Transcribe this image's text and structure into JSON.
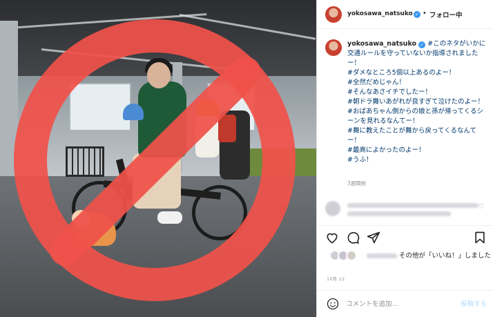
{
  "header": {
    "username": "yokosawa_natsuko",
    "separator": "•",
    "follow_label": "フォロー中"
  },
  "caption": {
    "username": "yokosawa_natsuko",
    "first_line": "#このネタがいかに交通ルールを守っていないか指導されましたー！",
    "tags": [
      "#ダメなところ5個以上あるのよー！",
      "#全然だめじゃん！",
      "#そんなあさイチでしたー！",
      "#朝ドラ舞いあがれが良すぎて泣けたのよー！",
      "#おばあちゃん側からの娘と孫が帰ってくるシーンを見れるなんてー！",
      "#舞に教えたことが舞から戻ってくるなんてー！",
      "#最高によかったのよー！",
      "#うふ！"
    ],
    "time_ago": "3週間前"
  },
  "likes": {
    "suffix": "その他が「いいね！」しました"
  },
  "date": "10月 12",
  "comment": {
    "placeholder": "コメントを追加...",
    "post_label": "投稿する"
  },
  "icons": {
    "verified": "verified-badge-icon",
    "heart": "heart-icon",
    "comment": "comment-icon",
    "share": "share-icon",
    "save": "bookmark-icon",
    "emoji": "emoji-icon",
    "prohibition": "prohibition-sign"
  },
  "colors": {
    "prohibition_red": "#f0524a",
    "verified_blue": "#3897f0",
    "hashtag_link": "#00376b",
    "post_button": "#b3dbff"
  }
}
